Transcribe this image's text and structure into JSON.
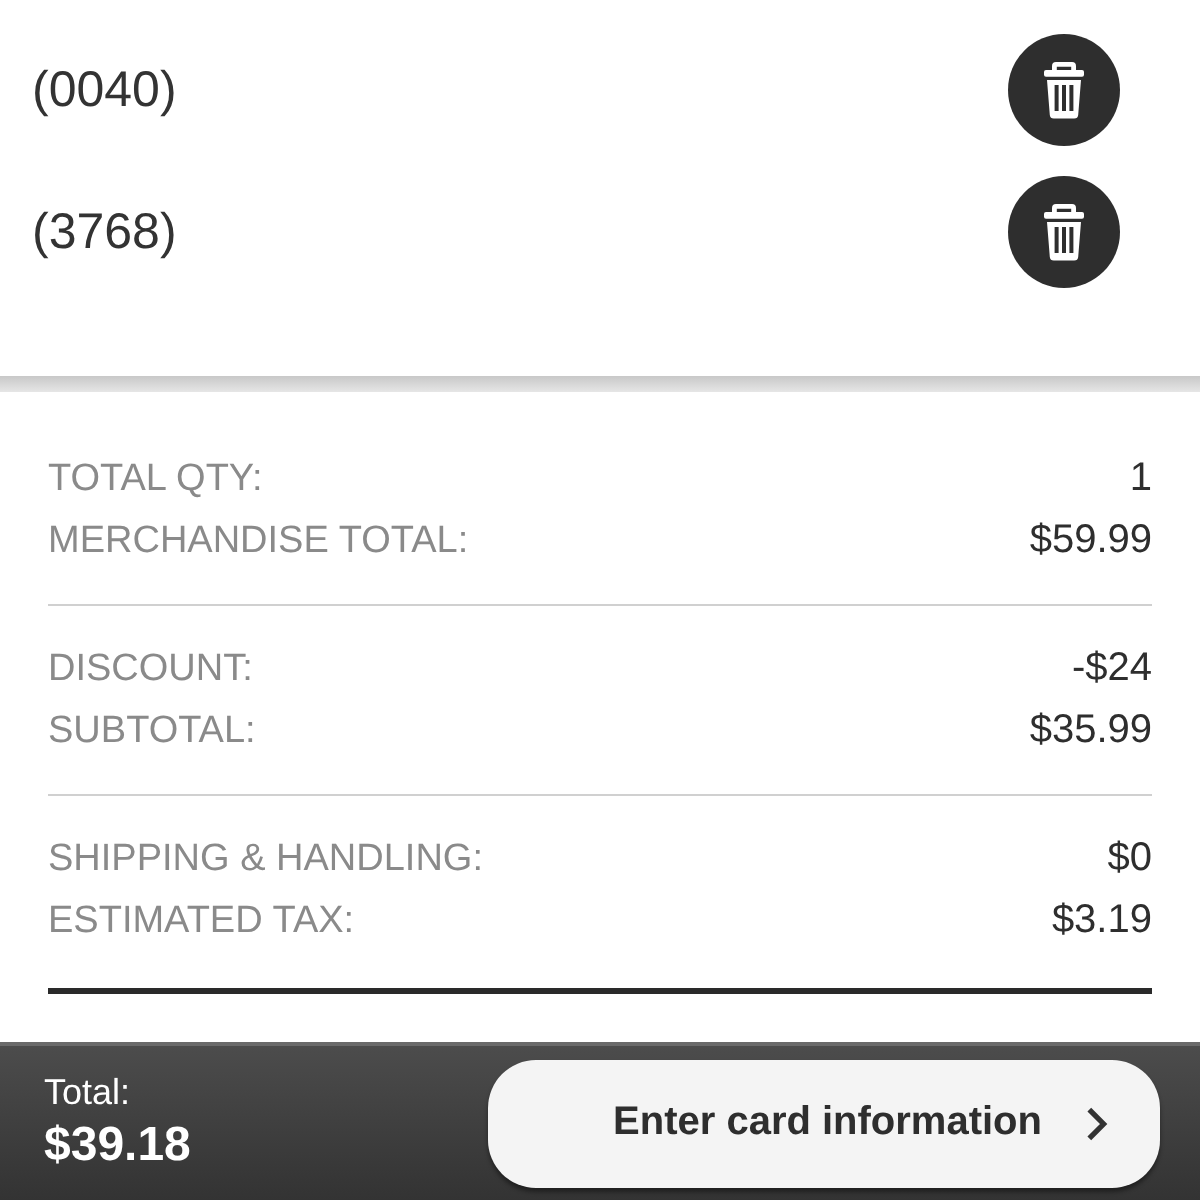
{
  "saved_cards": [
    {
      "label": "(0040)"
    },
    {
      "label": "(3768)"
    }
  ],
  "summary": {
    "groups": [
      [
        {
          "label": "TOTAL QTY:",
          "value": "1"
        },
        {
          "label": "MERCHANDISE TOTAL:",
          "value": "$59.99"
        }
      ],
      [
        {
          "label": "DISCOUNT:",
          "value": "-$24"
        },
        {
          "label": "SUBTOTAL:",
          "value": "$35.99"
        }
      ],
      [
        {
          "label": "SHIPPING & HANDLING:",
          "value": "$0"
        },
        {
          "label": "ESTIMATED TAX:",
          "value": "$3.19"
        }
      ]
    ]
  },
  "footer": {
    "total_label": "Total:",
    "total_value": "$39.18",
    "button": {
      "label": "Enter card information"
    }
  }
}
